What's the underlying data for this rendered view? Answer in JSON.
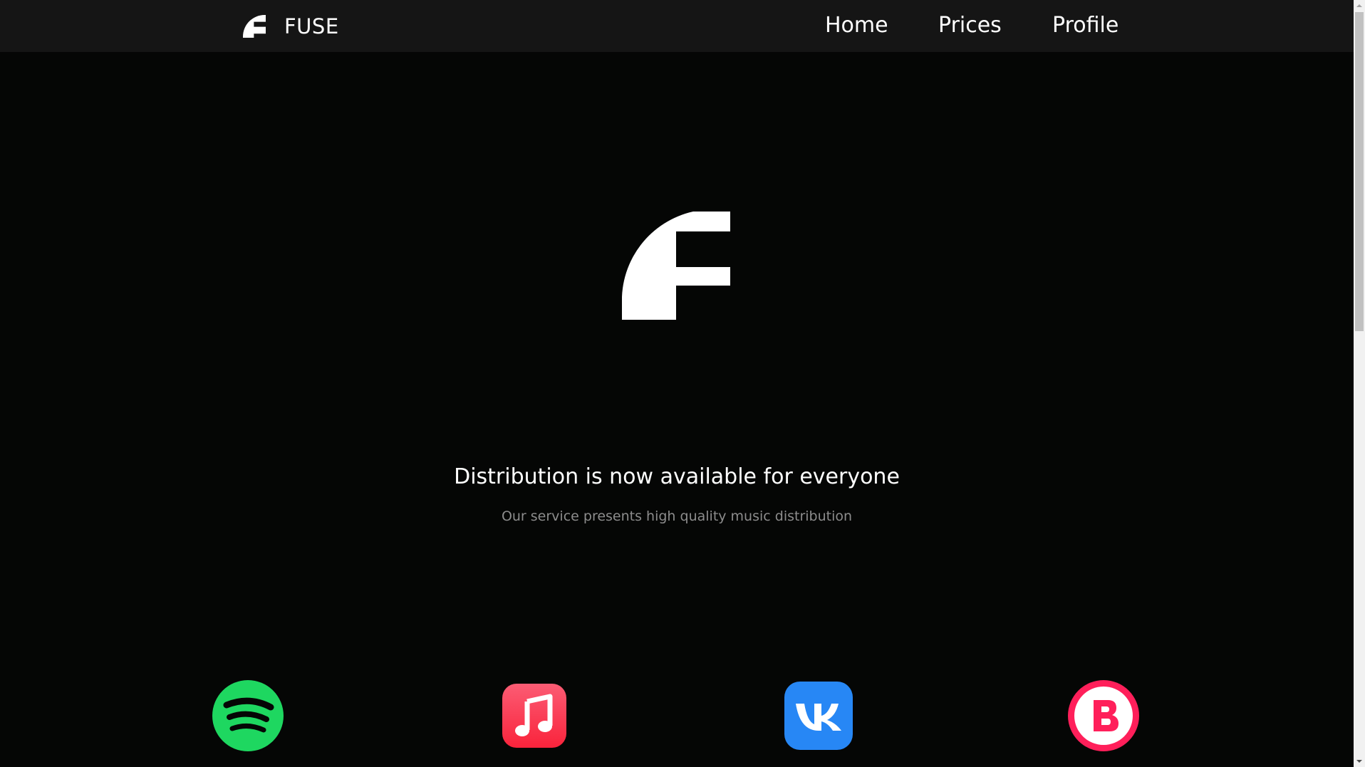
{
  "header": {
    "brand_name": "FUSE",
    "brand_icon": "fuse-logo-icon",
    "nav": [
      {
        "label": "Home"
      },
      {
        "label": "Prices"
      },
      {
        "label": "Profile"
      }
    ]
  },
  "hero": {
    "logo_icon": "fuse-logo-icon",
    "headline": "Distribution is now available for everyone",
    "subheadline": "Our service presents high quality music distribution"
  },
  "platforms": [
    {
      "name": "spotify-icon",
      "color": "#1ed760"
    },
    {
      "name": "apple-music-icon",
      "color": "#fa2d48"
    },
    {
      "name": "vk-icon",
      "color": "#2787f5"
    },
    {
      "name": "boom-icon",
      "color": "#ff1f5a"
    }
  ],
  "colors": {
    "background": "#050605",
    "header_bg": "#151515",
    "text_primary": "#ffffff",
    "text_secondary": "#8c8c8c"
  }
}
